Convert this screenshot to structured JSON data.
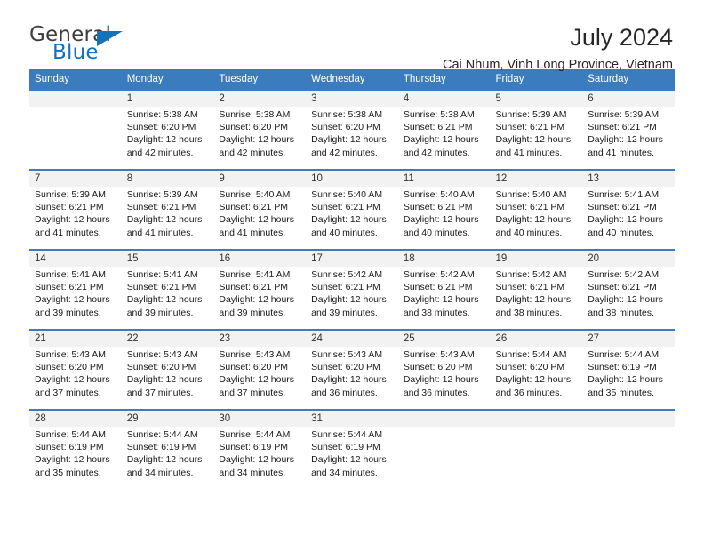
{
  "brand": {
    "name_top": "General",
    "name_bottom": "Blue",
    "color_dark": "#3d3d3d",
    "color_blue": "#1272bc"
  },
  "header": {
    "title": "July 2024",
    "subtitle": "Cai Nhum, Vinh Long Province, Vietnam"
  },
  "theme": {
    "header_bg": "#3a7cbe",
    "header_text": "#ffffff",
    "daynum_bg": "#f2f2f2",
    "cell_bg": "#ffffff",
    "separator": "#3a7cbe"
  },
  "weekdays": [
    "Sunday",
    "Monday",
    "Tuesday",
    "Wednesday",
    "Thursday",
    "Friday",
    "Saturday"
  ],
  "weeks": [
    {
      "days": [
        {
          "num": "",
          "sunrise": "",
          "sunset": "",
          "daylight_1": "",
          "daylight_2": ""
        },
        {
          "num": "1",
          "sunrise": "Sunrise: 5:38 AM",
          "sunset": "Sunset: 6:20 PM",
          "daylight_1": "Daylight: 12 hours",
          "daylight_2": "and 42 minutes."
        },
        {
          "num": "2",
          "sunrise": "Sunrise: 5:38 AM",
          "sunset": "Sunset: 6:20 PM",
          "daylight_1": "Daylight: 12 hours",
          "daylight_2": "and 42 minutes."
        },
        {
          "num": "3",
          "sunrise": "Sunrise: 5:38 AM",
          "sunset": "Sunset: 6:20 PM",
          "daylight_1": "Daylight: 12 hours",
          "daylight_2": "and 42 minutes."
        },
        {
          "num": "4",
          "sunrise": "Sunrise: 5:38 AM",
          "sunset": "Sunset: 6:21 PM",
          "daylight_1": "Daylight: 12 hours",
          "daylight_2": "and 42 minutes."
        },
        {
          "num": "5",
          "sunrise": "Sunrise: 5:39 AM",
          "sunset": "Sunset: 6:21 PM",
          "daylight_1": "Daylight: 12 hours",
          "daylight_2": "and 41 minutes."
        },
        {
          "num": "6",
          "sunrise": "Sunrise: 5:39 AM",
          "sunset": "Sunset: 6:21 PM",
          "daylight_1": "Daylight: 12 hours",
          "daylight_2": "and 41 minutes."
        }
      ]
    },
    {
      "days": [
        {
          "num": "7",
          "sunrise": "Sunrise: 5:39 AM",
          "sunset": "Sunset: 6:21 PM",
          "daylight_1": "Daylight: 12 hours",
          "daylight_2": "and 41 minutes."
        },
        {
          "num": "8",
          "sunrise": "Sunrise: 5:39 AM",
          "sunset": "Sunset: 6:21 PM",
          "daylight_1": "Daylight: 12 hours",
          "daylight_2": "and 41 minutes."
        },
        {
          "num": "9",
          "sunrise": "Sunrise: 5:40 AM",
          "sunset": "Sunset: 6:21 PM",
          "daylight_1": "Daylight: 12 hours",
          "daylight_2": "and 41 minutes."
        },
        {
          "num": "10",
          "sunrise": "Sunrise: 5:40 AM",
          "sunset": "Sunset: 6:21 PM",
          "daylight_1": "Daylight: 12 hours",
          "daylight_2": "and 40 minutes."
        },
        {
          "num": "11",
          "sunrise": "Sunrise: 5:40 AM",
          "sunset": "Sunset: 6:21 PM",
          "daylight_1": "Daylight: 12 hours",
          "daylight_2": "and 40 minutes."
        },
        {
          "num": "12",
          "sunrise": "Sunrise: 5:40 AM",
          "sunset": "Sunset: 6:21 PM",
          "daylight_1": "Daylight: 12 hours",
          "daylight_2": "and 40 minutes."
        },
        {
          "num": "13",
          "sunrise": "Sunrise: 5:41 AM",
          "sunset": "Sunset: 6:21 PM",
          "daylight_1": "Daylight: 12 hours",
          "daylight_2": "and 40 minutes."
        }
      ]
    },
    {
      "days": [
        {
          "num": "14",
          "sunrise": "Sunrise: 5:41 AM",
          "sunset": "Sunset: 6:21 PM",
          "daylight_1": "Daylight: 12 hours",
          "daylight_2": "and 39 minutes."
        },
        {
          "num": "15",
          "sunrise": "Sunrise: 5:41 AM",
          "sunset": "Sunset: 6:21 PM",
          "daylight_1": "Daylight: 12 hours",
          "daylight_2": "and 39 minutes."
        },
        {
          "num": "16",
          "sunrise": "Sunrise: 5:41 AM",
          "sunset": "Sunset: 6:21 PM",
          "daylight_1": "Daylight: 12 hours",
          "daylight_2": "and 39 minutes."
        },
        {
          "num": "17",
          "sunrise": "Sunrise: 5:42 AM",
          "sunset": "Sunset: 6:21 PM",
          "daylight_1": "Daylight: 12 hours",
          "daylight_2": "and 39 minutes."
        },
        {
          "num": "18",
          "sunrise": "Sunrise: 5:42 AM",
          "sunset": "Sunset: 6:21 PM",
          "daylight_1": "Daylight: 12 hours",
          "daylight_2": "and 38 minutes."
        },
        {
          "num": "19",
          "sunrise": "Sunrise: 5:42 AM",
          "sunset": "Sunset: 6:21 PM",
          "daylight_1": "Daylight: 12 hours",
          "daylight_2": "and 38 minutes."
        },
        {
          "num": "20",
          "sunrise": "Sunrise: 5:42 AM",
          "sunset": "Sunset: 6:21 PM",
          "daylight_1": "Daylight: 12 hours",
          "daylight_2": "and 38 minutes."
        }
      ]
    },
    {
      "days": [
        {
          "num": "21",
          "sunrise": "Sunrise: 5:43 AM",
          "sunset": "Sunset: 6:20 PM",
          "daylight_1": "Daylight: 12 hours",
          "daylight_2": "and 37 minutes."
        },
        {
          "num": "22",
          "sunrise": "Sunrise: 5:43 AM",
          "sunset": "Sunset: 6:20 PM",
          "daylight_1": "Daylight: 12 hours",
          "daylight_2": "and 37 minutes."
        },
        {
          "num": "23",
          "sunrise": "Sunrise: 5:43 AM",
          "sunset": "Sunset: 6:20 PM",
          "daylight_1": "Daylight: 12 hours",
          "daylight_2": "and 37 minutes."
        },
        {
          "num": "24",
          "sunrise": "Sunrise: 5:43 AM",
          "sunset": "Sunset: 6:20 PM",
          "daylight_1": "Daylight: 12 hours",
          "daylight_2": "and 36 minutes."
        },
        {
          "num": "25",
          "sunrise": "Sunrise: 5:43 AM",
          "sunset": "Sunset: 6:20 PM",
          "daylight_1": "Daylight: 12 hours",
          "daylight_2": "and 36 minutes."
        },
        {
          "num": "26",
          "sunrise": "Sunrise: 5:44 AM",
          "sunset": "Sunset: 6:20 PM",
          "daylight_1": "Daylight: 12 hours",
          "daylight_2": "and 36 minutes."
        },
        {
          "num": "27",
          "sunrise": "Sunrise: 5:44 AM",
          "sunset": "Sunset: 6:19 PM",
          "daylight_1": "Daylight: 12 hours",
          "daylight_2": "and 35 minutes."
        }
      ]
    },
    {
      "days": [
        {
          "num": "28",
          "sunrise": "Sunrise: 5:44 AM",
          "sunset": "Sunset: 6:19 PM",
          "daylight_1": "Daylight: 12 hours",
          "daylight_2": "and 35 minutes."
        },
        {
          "num": "29",
          "sunrise": "Sunrise: 5:44 AM",
          "sunset": "Sunset: 6:19 PM",
          "daylight_1": "Daylight: 12 hours",
          "daylight_2": "and 34 minutes."
        },
        {
          "num": "30",
          "sunrise": "Sunrise: 5:44 AM",
          "sunset": "Sunset: 6:19 PM",
          "daylight_1": "Daylight: 12 hours",
          "daylight_2": "and 34 minutes."
        },
        {
          "num": "31",
          "sunrise": "Sunrise: 5:44 AM",
          "sunset": "Sunset: 6:19 PM",
          "daylight_1": "Daylight: 12 hours",
          "daylight_2": "and 34 minutes."
        },
        {
          "num": "",
          "sunrise": "",
          "sunset": "",
          "daylight_1": "",
          "daylight_2": ""
        },
        {
          "num": "",
          "sunrise": "",
          "sunset": "",
          "daylight_1": "",
          "daylight_2": ""
        },
        {
          "num": "",
          "sunrise": "",
          "sunset": "",
          "daylight_1": "",
          "daylight_2": ""
        }
      ]
    }
  ]
}
